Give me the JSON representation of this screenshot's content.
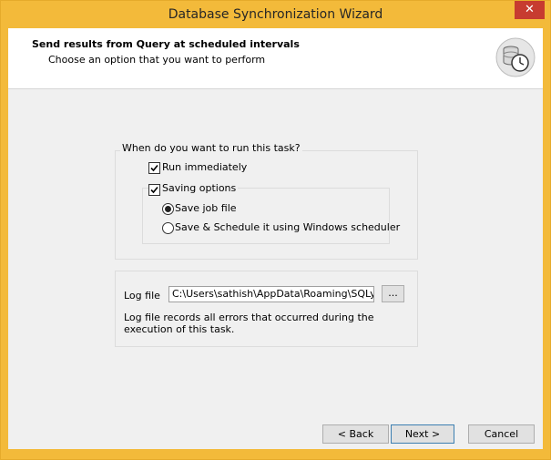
{
  "window": {
    "title": "Database Synchronization Wizard",
    "close_glyph": "✕"
  },
  "header": {
    "title": "Send results from Query at scheduled intervals",
    "subtitle": "Choose an option that you want to perform",
    "icon": "database-clock-icon"
  },
  "schedule": {
    "legend": "When do you want to run this task?",
    "run_immediately": {
      "label": "Run immediately",
      "checked": true
    },
    "saving_options": {
      "label": "Saving options",
      "checked": true
    },
    "save_job_file": {
      "label": "Save job file",
      "selected": true
    },
    "save_schedule": {
      "label": "Save & Schedule it using Windows scheduler",
      "selected": false
    }
  },
  "log": {
    "label": "Log file",
    "path": "C:\\Users\\sathish\\AppData\\Roaming\\SQLyog\\s",
    "browse_label": "...",
    "note": "Log file records all errors that occurred during the execution of this task."
  },
  "buttons": {
    "back": "< Back",
    "next": "Next >",
    "cancel": "Cancel"
  },
  "colors": {
    "frame": "#f3ba3a",
    "close": "#c73b30"
  }
}
